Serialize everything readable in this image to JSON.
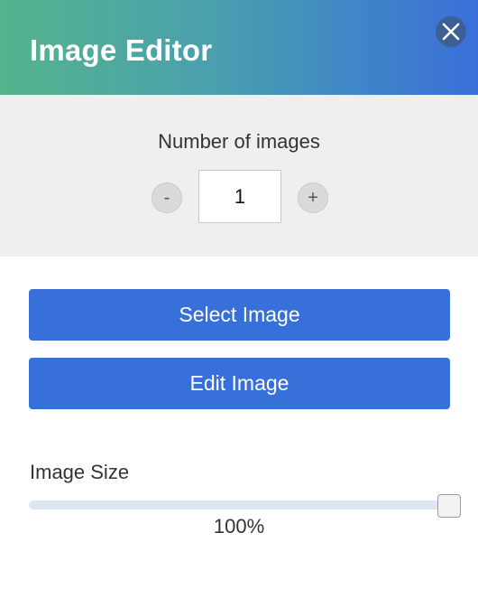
{
  "header": {
    "title": "Image Editor",
    "close_icon": "close-icon"
  },
  "count": {
    "label": "Number of images",
    "value": "1",
    "minus_label": "-",
    "plus_label": "+"
  },
  "actions": {
    "select_label": "Select Image",
    "edit_label": "Edit Image"
  },
  "size": {
    "label": "Image Size",
    "value_text": "100%",
    "level_percent": 100
  },
  "colors": {
    "accent": "#3670d8",
    "header_gradient_start": "#55b48c",
    "header_gradient_end": "#3a6fd9",
    "panel_bg": "#efefef"
  }
}
